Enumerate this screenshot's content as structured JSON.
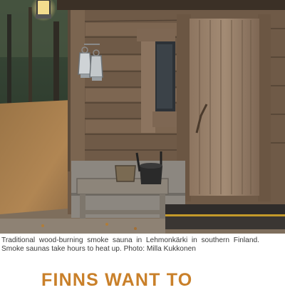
{
  "article": {
    "photo": {
      "subject": "Traditional wood-burning smoke sauna exterior",
      "accent_colors": {
        "wood": "#8a6a4c",
        "leaves": "#a07a48",
        "lantern": "#d9d9d9",
        "lamp_glow": "#ffd87a"
      }
    },
    "caption": {
      "line1": "Traditional wood-burning smoke sauna in Lehmonkärki in southern Finland.",
      "line2": "Smoke saunas take hours to heat up. Photo: Milla Kukkonen"
    },
    "headline": "FINNS WANT TO",
    "headline_color": "#c9802a"
  }
}
